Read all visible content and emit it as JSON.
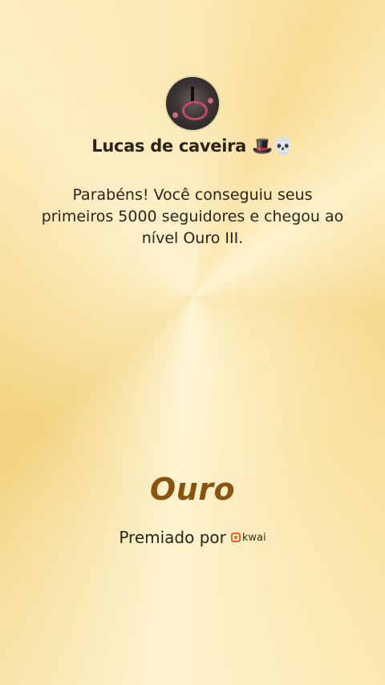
{
  "profile": {
    "avatar_icon": "avatar-image",
    "name": "Lucas de caveira 🎩💀"
  },
  "message": {
    "text": "Parabéns! Você conseguiu seus primeiros 5000 seguidores e chegou ao nível Ouro III."
  },
  "tier": {
    "label": "Ouro"
  },
  "award": {
    "label": "Premiado por",
    "brand": "kwai",
    "brand_icon": "kwai-logo-icon",
    "brand_color": "#e8612c"
  },
  "theme": {
    "gold_text": "#8a5410",
    "dark_text": "#2b2418"
  }
}
